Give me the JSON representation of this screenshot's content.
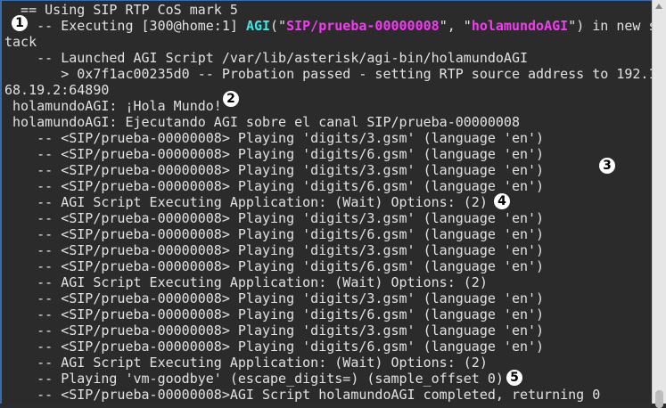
{
  "terminal": {
    "lines": [
      [
        {
          "t": "  == Using SIP RTP CoS mark 5"
        }
      ],
      [
        {
          "t": "    -- Executing [300@home:1] "
        },
        {
          "t": "AGI",
          "c": "cyan"
        },
        {
          "t": "(\""
        },
        {
          "t": "SIP/prueba-00000008",
          "c": "mag"
        },
        {
          "t": "\", \""
        },
        {
          "t": "holamundoAGI",
          "c": "mag"
        },
        {
          "t": "\") in new s"
        }
      ],
      [
        {
          "t": "tack"
        }
      ],
      [
        {
          "t": "    -- Launched AGI Script /var/lib/asterisk/agi-bin/holamundoAGI"
        }
      ],
      [
        {
          "t": "       > 0x7f1ac00235d0 -- Probation passed - setting RTP source address to 192.1"
        }
      ],
      [
        {
          "t": "68.19.2:64890"
        }
      ],
      [
        {
          "t": " holamundoAGI: ¡Hola Mundo!"
        }
      ],
      [
        {
          "t": " holamundoAGI: Ejecutando AGI sobre el canal SIP/prueba-00000008"
        }
      ],
      [
        {
          "t": "    -- <SIP/prueba-00000008> Playing 'digits/3.gsm' (language 'en')"
        }
      ],
      [
        {
          "t": "    -- <SIP/prueba-00000008> Playing 'digits/6.gsm' (language 'en')"
        }
      ],
      [
        {
          "t": "    -- <SIP/prueba-00000008> Playing 'digits/3.gsm' (language 'en')"
        }
      ],
      [
        {
          "t": "    -- <SIP/prueba-00000008> Playing 'digits/6.gsm' (language 'en')"
        }
      ],
      [
        {
          "t": "    -- AGI Script Executing Application: (Wait) Options: (2)"
        }
      ],
      [
        {
          "t": "    -- <SIP/prueba-00000008> Playing 'digits/3.gsm' (language 'en')"
        }
      ],
      [
        {
          "t": "    -- <SIP/prueba-00000008> Playing 'digits/6.gsm' (language 'en')"
        }
      ],
      [
        {
          "t": "    -- <SIP/prueba-00000008> Playing 'digits/3.gsm' (language 'en')"
        }
      ],
      [
        {
          "t": "    -- <SIP/prueba-00000008> Playing 'digits/6.gsm' (language 'en')"
        }
      ],
      [
        {
          "t": "    -- AGI Script Executing Application: (Wait) Options: (2)"
        }
      ],
      [
        {
          "t": "    -- <SIP/prueba-00000008> Playing 'digits/3.gsm' (language 'en')"
        }
      ],
      [
        {
          "t": "    -- <SIP/prueba-00000008> Playing 'digits/6.gsm' (language 'en')"
        }
      ],
      [
        {
          "t": "    -- <SIP/prueba-00000008> Playing 'digits/3.gsm' (language 'en')"
        }
      ],
      [
        {
          "t": "    -- <SIP/prueba-00000008> Playing 'digits/6.gsm' (language 'en')"
        }
      ],
      [
        {
          "t": "    -- AGI Script Executing Application: (Wait) Options: (2)"
        }
      ],
      [
        {
          "t": "    -- Playing 'vm-goodbye' (escape_digits=) (sample_offset 0)"
        }
      ],
      [
        {
          "t": "    -- <SIP/prueba-00000008>AGI Script holamundoAGI completed, returning 0"
        }
      ]
    ],
    "badges": [
      "1",
      "2",
      "3",
      "4",
      "5"
    ],
    "colors": {
      "background": "#2b2b2b",
      "text": "#e2e2e2",
      "cyan": "#3ee6e6",
      "magenta": "#f23cf2"
    }
  }
}
